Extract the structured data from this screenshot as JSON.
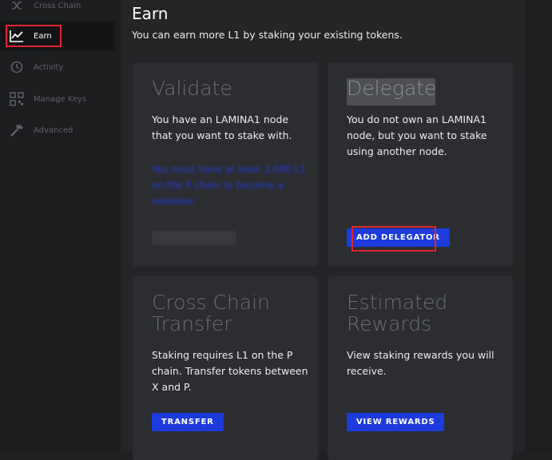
{
  "sidebar": {
    "items": [
      {
        "label": "Cross Chain",
        "icon": "shuffle-icon"
      },
      {
        "label": "Earn",
        "icon": "chart-line-icon",
        "active": true
      },
      {
        "label": "Activity",
        "icon": "history-icon"
      },
      {
        "label": "Manage Keys",
        "icon": "qr-code-icon"
      },
      {
        "label": "Advanced",
        "icon": "hammer-icon"
      }
    ]
  },
  "header": {
    "title": "Earn",
    "subtitle": "You can earn more L1 by staking your existing tokens."
  },
  "cards": {
    "validate": {
      "title": "Validate",
      "description": "You have an LAMINA1 node that you want to stake with.",
      "warning": "You must have at least 2,000 L1 on the P chain to become a validator."
    },
    "delegate": {
      "title": "Delegate",
      "description": "You do not own an LAMINA1 node, but you want to stake using another node.",
      "button": "ADD DELEGATOR"
    },
    "transfer": {
      "title_line1": "Cross Chain",
      "title_line2": "Transfer",
      "description": "Staking requires L1 on the P chain. Transfer tokens between X and P.",
      "button": "TRANSFER"
    },
    "rewards": {
      "title_line1": "Estimated",
      "title_line2": "Rewards",
      "description": "View staking rewards you will receive.",
      "button": "VIEW REWARDS"
    }
  },
  "colors": {
    "accent": "#1d3bdc",
    "highlight": "#e0262d",
    "card": "#2c2d30"
  }
}
